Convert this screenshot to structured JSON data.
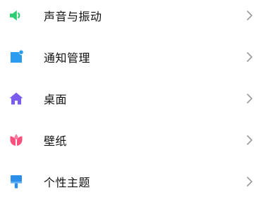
{
  "settings": {
    "items": [
      {
        "label": "声音与振动",
        "icon": "speaker-icon",
        "color": "#2ecc71"
      },
      {
        "label": "通知管理",
        "icon": "notification-icon",
        "color": "#2b9cf0"
      },
      {
        "label": "桌面",
        "icon": "home-icon",
        "color": "#7b5cf0"
      },
      {
        "label": "壁纸",
        "icon": "flower-icon",
        "color": "#ff4f7d"
      },
      {
        "label": "个性主题",
        "icon": "paintbrush-icon",
        "color": "#2b8ee8"
      }
    ]
  },
  "chevron_color": "#9a9a9a"
}
